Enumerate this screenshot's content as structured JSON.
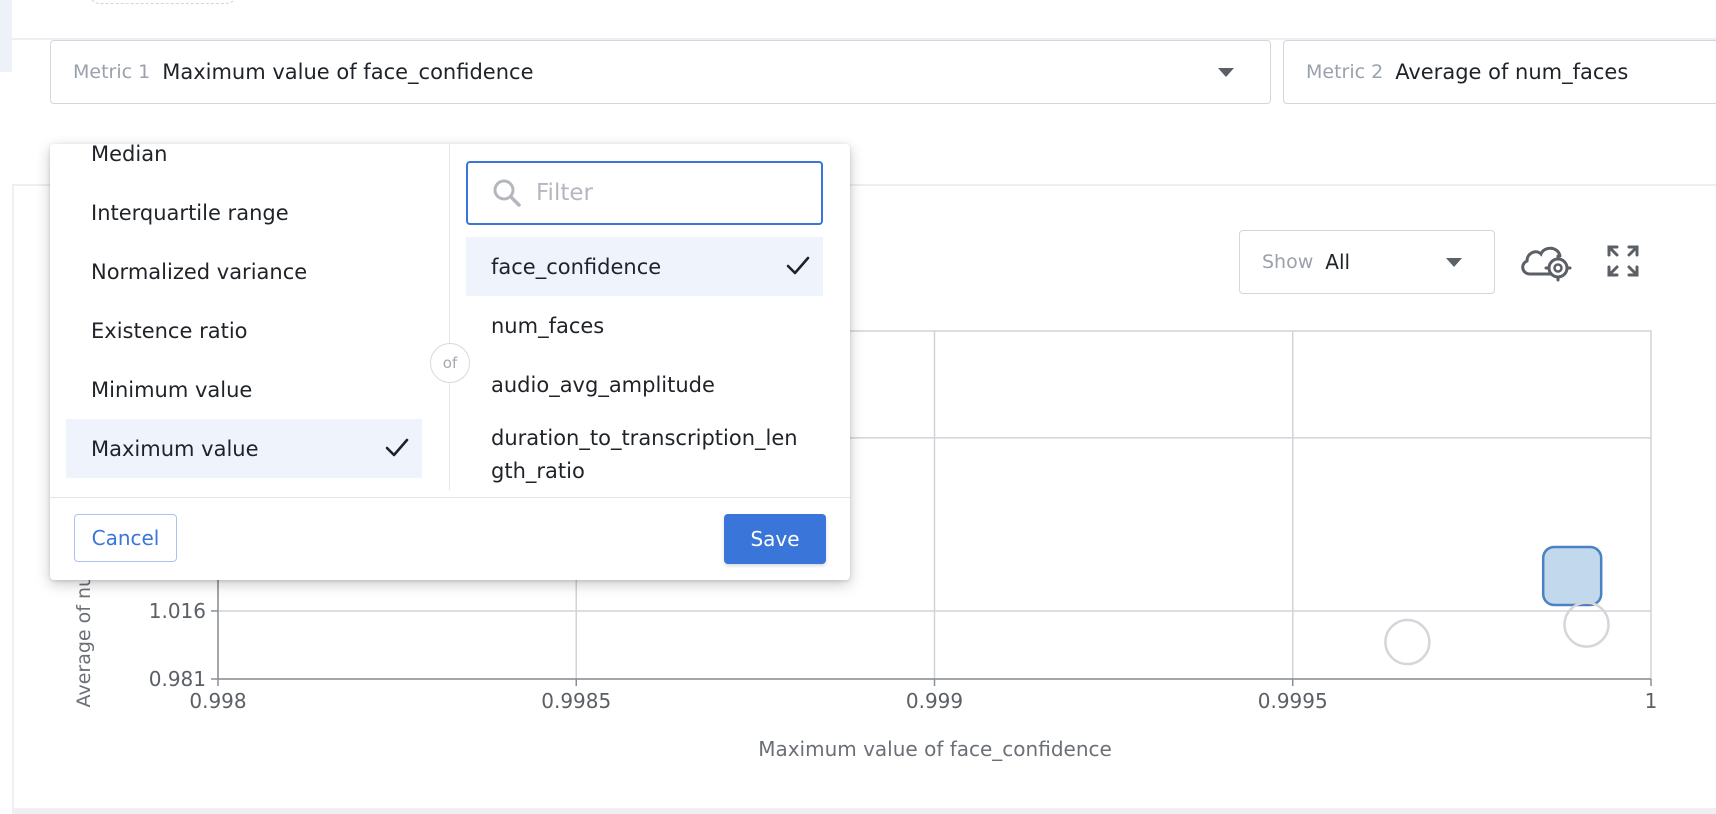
{
  "metric1": {
    "label": "Metric 1",
    "value": "Maximum value of face_confidence"
  },
  "metric2": {
    "label": "Metric 2",
    "value": "Average of num_faces"
  },
  "show": {
    "label": "Show",
    "value": "All"
  },
  "icons": {
    "settings": "cloud-gear-icon",
    "fullscreen": "expand-icon",
    "search": "search-icon",
    "check": "checkmark-icon"
  },
  "colors": {
    "accent": "#3a76da",
    "selected_bg": "#eef3fc",
    "point_fill": "#c2d8ec",
    "point_stroke": "#4a82c4"
  },
  "dropdown": {
    "aggregations": [
      {
        "label": "Median",
        "selected": false
      },
      {
        "label": "Interquartile range",
        "selected": false
      },
      {
        "label": "Normalized variance",
        "selected": false
      },
      {
        "label": "Existence ratio",
        "selected": false
      },
      {
        "label": "Minimum value",
        "selected": false
      },
      {
        "label": "Maximum value",
        "selected": true
      }
    ],
    "of_label": "of",
    "filter_placeholder": "Filter",
    "fields": [
      {
        "label": "face_confidence",
        "selected": true
      },
      {
        "label": "num_faces",
        "selected": false
      },
      {
        "label": "audio_avg_amplitude",
        "selected": false
      },
      {
        "label": "duration_to_transcription_length_ratio",
        "selected": false
      }
    ],
    "cancel_label": "Cancel",
    "save_label": "Save"
  },
  "chart_data": {
    "type": "scatter",
    "xlabel": "Maximum value of face_confidence",
    "ylabel": "Average of num_faces",
    "x_ticks": [
      "0.998",
      "0.9985",
      "0.999",
      "0.9995",
      "1"
    ],
    "y_ticks": [
      "0.981",
      "1.016"
    ],
    "xlim": [
      0.998,
      1.0
    ],
    "ylim": [
      0.981,
      1.16
    ],
    "grid": true,
    "points": [
      {
        "x": 0.99989,
        "y": 1.034,
        "highlighted": true
      },
      {
        "x": 0.99966,
        "y": 1.0,
        "highlighted": false
      },
      {
        "x": 0.99991,
        "y": 1.009,
        "highlighted": false
      }
    ]
  }
}
